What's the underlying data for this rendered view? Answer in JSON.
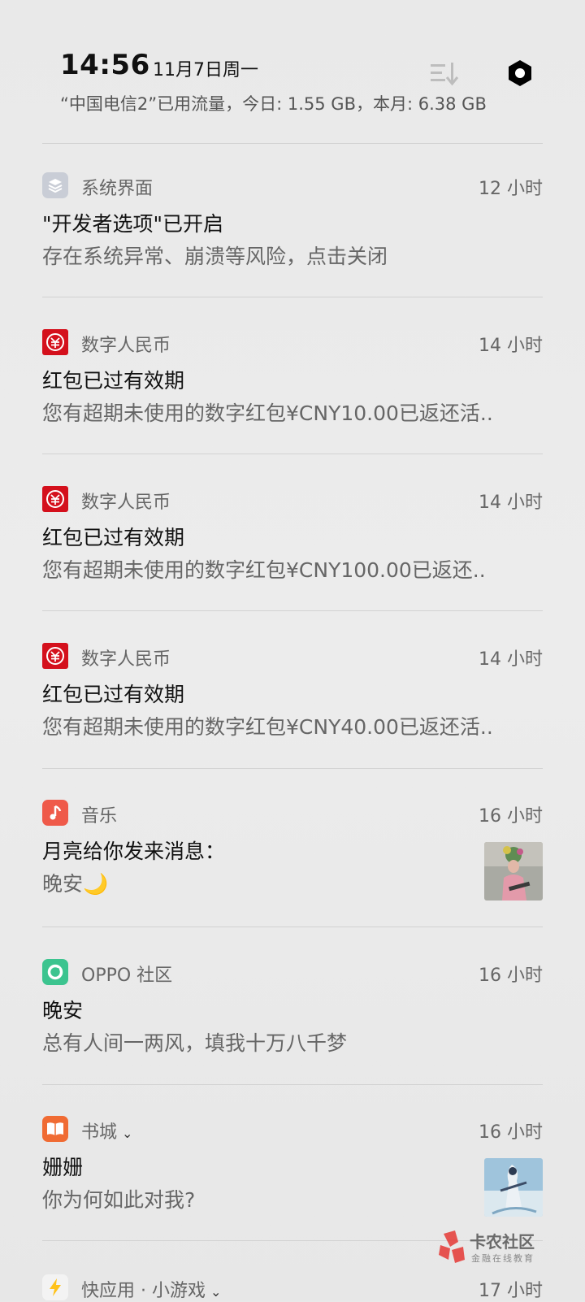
{
  "status_header": {
    "time": "14:56",
    "date": "11月7日周一",
    "data_usage": "“中国电信2”已用流量，今日: 1.55 GB，本月: 6.38 GB",
    "sort_icon": "notification-sort-icon",
    "settings_icon": "settings-hexagon-icon"
  },
  "notifications": [
    {
      "app": "系统界面",
      "time": "12 小时",
      "title": "\"开发者选项\"已开启",
      "body": "存在系统异常、崩溃等风险，点击关闭",
      "icon": "system-ui-icon",
      "icon_color": "#c9cdd6"
    },
    {
      "app": "数字人民币",
      "time": "14 小时",
      "title": "红包已过有效期",
      "body": "您有超期未使用的数字红包¥CNY10.00已返还活..",
      "icon": "digital-rmb-icon",
      "icon_color": "#d4101c"
    },
    {
      "app": "数字人民币",
      "time": "14 小时",
      "title": "红包已过有效期",
      "body": "您有超期未使用的数字红包¥CNY100.00已返还..",
      "icon": "digital-rmb-icon",
      "icon_color": "#d4101c"
    },
    {
      "app": "数字人民币",
      "time": "14 小时",
      "title": "红包已过有效期",
      "body": "您有超期未使用的数字红包¥CNY40.00已返还活..",
      "icon": "digital-rmb-icon",
      "icon_color": "#d4101c"
    },
    {
      "app": "音乐",
      "time": "16 小时",
      "title": "月亮给你发来消息：",
      "body": "晚安🌙",
      "icon": "music-note-icon",
      "icon_color": "#ef5a4a"
    },
    {
      "app": "OPPO 社区",
      "time": "16 小时",
      "title": "晚安",
      "body": "总有人间一两风，填我十万八千梦",
      "icon": "oppo-community-icon",
      "icon_color": "#3cc48f"
    },
    {
      "app": "书城",
      "time": "16 小时",
      "title": "姗姗",
      "body": "你为何如此对我?",
      "icon": "book-icon",
      "icon_color": "#f06b33"
    },
    {
      "app": "快应用 · 小游戏",
      "time": "17 小时",
      "icon": "quick-app-bolt-icon",
      "icon_color": "#ffc21a"
    }
  ],
  "watermark": {
    "name": "卡农社区",
    "tagline": "金融在线教育"
  }
}
